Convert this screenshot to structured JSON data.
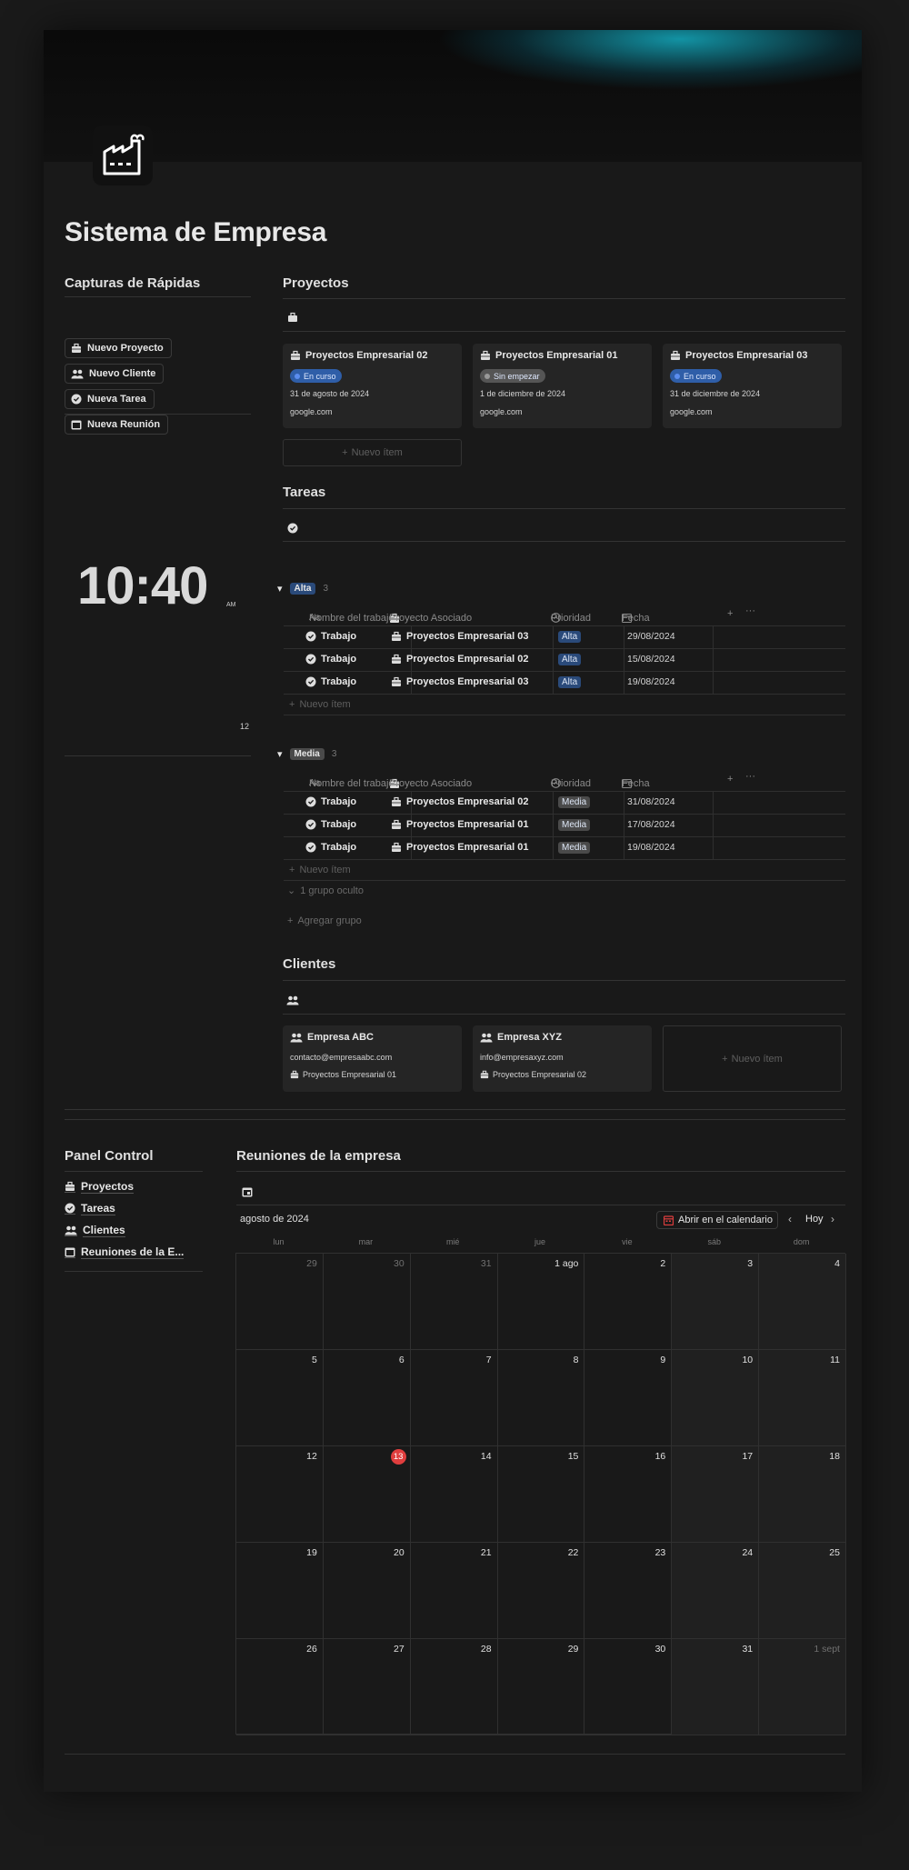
{
  "page": {
    "title": "Sistema de Empresa"
  },
  "quick": {
    "heading": "Capturas de Rápidas",
    "buttons": [
      {
        "label": "Nuevo Proyecto",
        "icon": "briefcase-icon"
      },
      {
        "label": "Nuevo Cliente",
        "icon": "people-icon"
      },
      {
        "label": "Nueva Tarea",
        "icon": "check-circle-icon"
      },
      {
        "label": "Nueva Reunión",
        "icon": "calendar-icon"
      }
    ]
  },
  "clock": {
    "time": "10:40",
    "ampm": "AM",
    "number": "12"
  },
  "projects": {
    "heading": "Proyectos",
    "cards": [
      {
        "title": "Proyectos Empresarial 02",
        "status": "En curso",
        "date": "31 de agosto de 2024",
        "link": "google.com"
      },
      {
        "title": "Proyectos Empresarial 01",
        "status": "Sin empezar",
        "date": "1 de diciembre de 2024",
        "link": "google.com"
      },
      {
        "title": "Proyectos Empresarial 03",
        "status": "En curso",
        "date": "31 de diciembre de 2024",
        "link": "google.com"
      }
    ],
    "new_item": "Nuevo ítem"
  },
  "tasks": {
    "heading": "Tareas",
    "columns": {
      "name": "Nombre del trabajo",
      "project": "Proyecto Asociado",
      "priority": "Prioridad",
      "date": "Fecha"
    },
    "groups": [
      {
        "label": "Alta",
        "count": "3",
        "rows": [
          {
            "name": "Trabajo",
            "project": "Proyectos Empresarial 03",
            "priority": "Alta",
            "date": "29/08/2024"
          },
          {
            "name": "Trabajo",
            "project": "Proyectos Empresarial 02",
            "priority": "Alta",
            "date": "15/08/2024"
          },
          {
            "name": "Trabajo",
            "project": "Proyectos Empresarial 03",
            "priority": "Alta",
            "date": "19/08/2024"
          }
        ]
      },
      {
        "label": "Media",
        "count": "3",
        "rows": [
          {
            "name": "Trabajo",
            "project": "Proyectos Empresarial 02",
            "priority": "Media",
            "date": "31/08/2024"
          },
          {
            "name": "Trabajo",
            "project": "Proyectos Empresarial 01",
            "priority": "Media",
            "date": "17/08/2024"
          },
          {
            "name": "Trabajo",
            "project": "Proyectos Empresarial 01",
            "priority": "Media",
            "date": "19/08/2024"
          }
        ]
      }
    ],
    "new_item": "Nuevo ítem",
    "hidden_group": "1 grupo oculto",
    "add_group": "Agregar grupo"
  },
  "clients": {
    "heading": "Clientes",
    "cards": [
      {
        "title": "Empresa ABC",
        "email": "contacto@empresaabc.com",
        "project": "Proyectos Empresarial 01"
      },
      {
        "title": "Empresa XYZ",
        "email": "info@empresaxyz.com",
        "project": "Proyectos Empresarial 02"
      }
    ],
    "new_item": "Nuevo ítem"
  },
  "panel": {
    "heading": "Panel Control",
    "items": [
      {
        "label": "Proyectos",
        "icon": "briefcase-icon"
      },
      {
        "label": "Tareas",
        "icon": "check-circle-icon"
      },
      {
        "label": "Clientes",
        "icon": "people-icon"
      },
      {
        "label": "Reuniones de la E...",
        "icon": "calendar-icon"
      }
    ]
  },
  "meetings": {
    "heading": "Reuniones de la empresa",
    "month": "agosto de 2024",
    "open_calendar": "Abrir en el calendario",
    "today": "Hoy",
    "weekdays": [
      "lun",
      "mar",
      "mié",
      "jue",
      "vie",
      "sáb",
      "dom"
    ],
    "days": [
      "29",
      "30",
      "31",
      "1 ago",
      "2",
      "3",
      "4",
      "5",
      "6",
      "7",
      "8",
      "9",
      "10",
      "11",
      "12",
      "13",
      "14",
      "15",
      "16",
      "17",
      "18",
      "19",
      "20",
      "21",
      "22",
      "23",
      "24",
      "25",
      "26",
      "27",
      "28",
      "29",
      "30",
      "31",
      "1 sept"
    ],
    "today_day": "13"
  },
  "colors": {
    "accent_teal": "#17aabe",
    "en_curso": "#2f5ea8",
    "sin_empezar": "#555555",
    "alta": "#2a4a7a",
    "media": "#4a4a4a",
    "today": "#e03e3e"
  }
}
